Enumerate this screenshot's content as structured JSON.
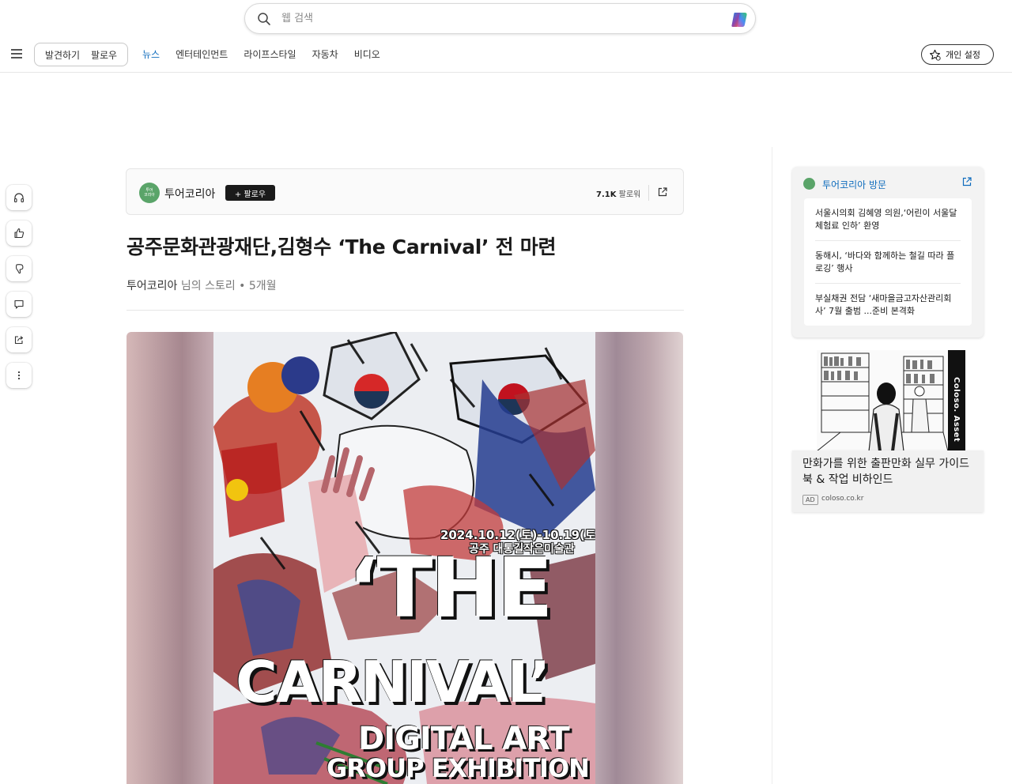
{
  "search": {
    "placeholder": "웹 검색"
  },
  "nav": {
    "pills": [
      "발견하기",
      "팔로우"
    ],
    "links": [
      "뉴스",
      "엔터테인먼트",
      "라이프스타일",
      "자동차",
      "비디오"
    ],
    "active_link": "뉴스",
    "personalize_label": "개인 설정"
  },
  "rail": {
    "actions": [
      "listen",
      "like",
      "dislike",
      "comment",
      "share",
      "more"
    ]
  },
  "publisher": {
    "name": "투어코리아",
    "logo_text": "투어\n코리아",
    "follow_label": "+ 팔로우",
    "followers_count": "7.1K",
    "followers_label": "팔로워"
  },
  "article": {
    "title": "공주문화관광재단,김형수 ‘The Carnival’ 전 마련",
    "byline_publisher": "투어코리아",
    "byline_suffix": " 님의 스토리 • ",
    "age": "5개월"
  },
  "poster": {
    "date": "2024.10.12(토)-10.19(토)",
    "venue": "공주 대통길작은미술관",
    "title_line1": "‘THE",
    "title_line2": "CARNIVAL’",
    "subtitle_line1": "DIGITAL ART",
    "subtitle_line2": "GROUP EXHIBITION"
  },
  "visit": {
    "title": "투어코리아 방문",
    "items": [
      "서울시의회 김혜영 의원,‘어린이 서울달 체험료 인하’ 환영",
      "동해시, ‘바다와 함께하는 철길 따라 플로깅’ 행사",
      "부실채권 전담 ‘새마을금고자산관리회사’ 7월 출범 ...준비 본격화"
    ]
  },
  "ad": {
    "brand_band": "Coloso. Asset",
    "headline": "만화가를 위한 출판만화 실무 가이드북 & 작업 비하인드",
    "badge": "AD",
    "domain": "coloso.co.kr"
  },
  "colors": {
    "accent": "#0f6cbd",
    "publisher_green": "#5aa469",
    "follow_button": "#1a1a1a"
  }
}
